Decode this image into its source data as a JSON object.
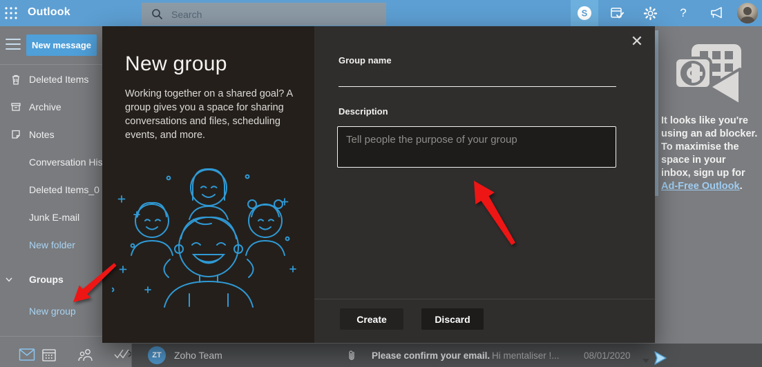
{
  "topbar": {
    "brand": "Outlook",
    "search_placeholder": "Search"
  },
  "sidebar": {
    "new_message_label": "New message",
    "folders": [
      {
        "label": "Deleted Items",
        "icon": "trash-icon"
      },
      {
        "label": "Archive",
        "icon": "archive-icon"
      },
      {
        "label": "Notes",
        "icon": "note-icon"
      },
      {
        "label": "Conversation His"
      },
      {
        "label": "Deleted Items_0"
      },
      {
        "label": "Junk E-mail"
      },
      {
        "label": "New folder"
      }
    ],
    "groups_header": "Groups",
    "new_group_link": "New group"
  },
  "modal": {
    "title": "New group",
    "description": "Working together on a shared goal? A group gives you a space for sharing conversations and files, scheduling events, and more.",
    "group_name_label": "Group name",
    "group_name_value": "",
    "description_label": "Description",
    "description_placeholder": "Tell people the purpose of your group",
    "create_label": "Create",
    "discard_label": "Discard",
    "close_glyph": "✕"
  },
  "ad_panel": {
    "text_before_link": "It looks like you're using an ad blocker. To maximise the space in your inbox, sign up for ",
    "link_text": "Ad-Free Outlook",
    "text_after_link": "."
  },
  "email_row": {
    "avatar_initials": "ZT",
    "sender": "Zoho Team",
    "subject": "Please confirm your email.",
    "preview": "Hi mentaliser !...",
    "date": "08/01/2020"
  },
  "colors": {
    "topbar_blue": "#5d9fd3",
    "accent_blue": "#4f9fd9",
    "link_blue": "#a9d3f2",
    "modal_left_bg": "#241f1b",
    "modal_right_bg": "#302e2d",
    "illustration_blue": "#2f99d4",
    "arrow_red": "#ee1515",
    "dim_gray": "#797b7e"
  }
}
